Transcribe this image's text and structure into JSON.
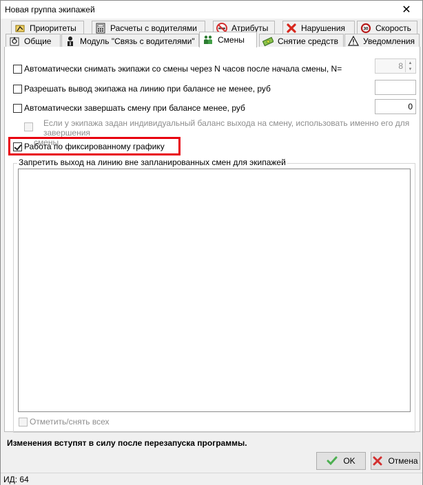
{
  "window": {
    "title": "Новая группа экипажей",
    "close_glyph": "✕"
  },
  "tabs": {
    "row1": [
      {
        "label": "Приоритеты",
        "icon": "priority-icon"
      },
      {
        "label": "Расчеты с водителями",
        "icon": "calculator-icon"
      },
      {
        "label": "Атрибуты",
        "icon": "no-smoking-icon"
      },
      {
        "label": "Нарушения",
        "icon": "red-x-icon"
      },
      {
        "label": "Скорость",
        "icon": "speed-limit-icon"
      }
    ],
    "row2": [
      {
        "label": "Общие",
        "icon": "settings-icon"
      },
      {
        "label": "Модуль \"Связь с водителями\"",
        "icon": "driver-icon"
      },
      {
        "label": "Смены",
        "icon": "people-icon"
      },
      {
        "label": "Снятие средств",
        "icon": "money-icon"
      },
      {
        "label": "Уведомления",
        "icon": "warning-icon"
      }
    ],
    "speed_badge": "30"
  },
  "settings": {
    "auto_remove": {
      "label": "Автоматически снимать экипажи со смены через N часов после начала смены, N=",
      "value": "8",
      "checked": false
    },
    "allow_balance": {
      "label": "Разрешать вывод экипажа на линию при балансе не менее, руб",
      "value": "",
      "checked": false
    },
    "auto_finish": {
      "label": "Автоматически завершать смену при балансе менее, руб",
      "value": "0",
      "checked": false
    },
    "individual_balance": {
      "label_line1": "Если у экипажа задан индивидуальный баланс выхода на смену, использовать именно его для завершения",
      "label_line2": "смены",
      "checked": false
    },
    "fixed_schedule": {
      "label": "Работа по фиксированному графику",
      "checked": true
    }
  },
  "group": {
    "label": "Запретить выход на линию вне запланированных смен для экипажей",
    "toggle_all": "Отметить/снять всех"
  },
  "footer": {
    "notice": "Изменения вступят в силу после перезапуска программы.",
    "ok": "OK",
    "cancel": "Отмена"
  },
  "status": {
    "id_text": "ИД: 64"
  },
  "colors": {
    "highlight": "#e8000f",
    "ok_check": "#4caf50",
    "cancel_x": "#d32f2f"
  }
}
